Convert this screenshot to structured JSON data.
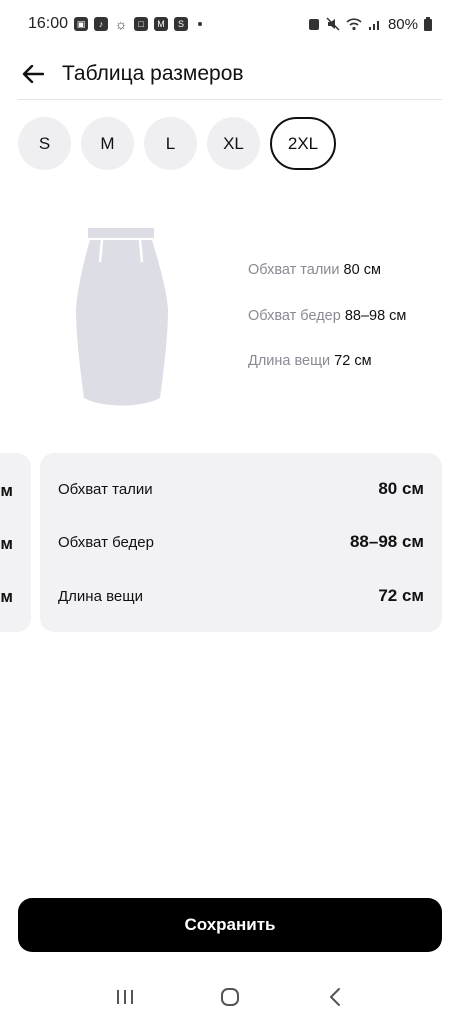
{
  "status_bar": {
    "time": "16:00",
    "battery": "80%"
  },
  "header": {
    "title": "Таблица размеров"
  },
  "sizes": {
    "options": [
      "S",
      "M",
      "L",
      "XL",
      "2XL"
    ],
    "selected": "2XL"
  },
  "summary": {
    "waist_label": "Обхват талии",
    "waist_value": "80 см",
    "hips_label": "Обхват бедер",
    "hips_value": "88–98 см",
    "length_label": "Длина вещи",
    "length_value": "72 см"
  },
  "carousel": {
    "prev_card": {
      "values": [
        "м",
        "м",
        "м"
      ]
    },
    "current_card": {
      "rows": [
        {
          "label": "Обхват талии",
          "value": "80 см"
        },
        {
          "label": "Обхват бедер",
          "value": "88–98 см"
        },
        {
          "label": "Длина вещи",
          "value": "72 см"
        }
      ]
    }
  },
  "footer": {
    "save_label": "Сохранить"
  },
  "icons": {
    "back": "arrow-left-icon",
    "nav_recents": "recents-icon",
    "nav_home": "home-icon",
    "nav_back": "chevron-left-icon"
  },
  "colors": {
    "chip_bg": "#efeff2",
    "card_bg": "#f2f2f5",
    "primary_button": "#000000",
    "muted_text": "#8a8a95",
    "illustration": "#dddde6"
  }
}
